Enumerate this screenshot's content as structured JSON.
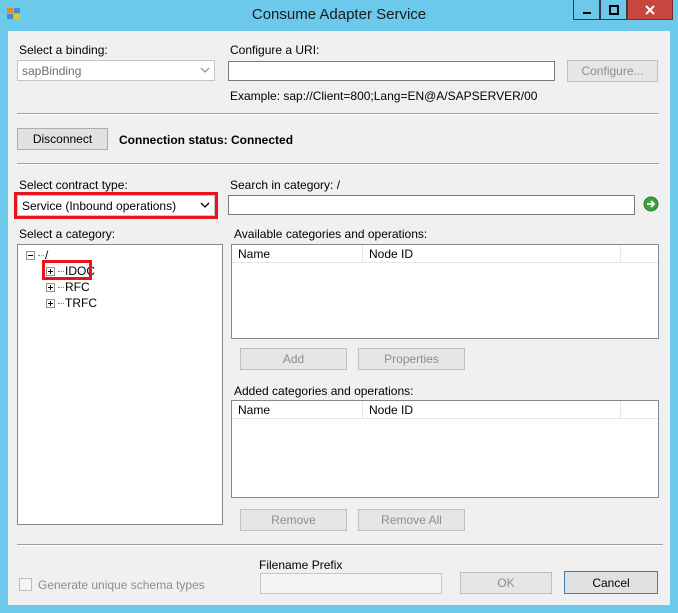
{
  "window": {
    "title": "Consume Adapter Service"
  },
  "binding": {
    "label": "Select a binding:",
    "value": "sapBinding"
  },
  "uri": {
    "label": "Configure a URI:",
    "value": "",
    "configure_label": "Configure...",
    "example": "Example: sap://Client=800;Lang=EN@A/SAPSERVER/00"
  },
  "connection": {
    "disconnect_label": "Disconnect",
    "status_label": "Connection status:",
    "status_value": "Connected"
  },
  "contract": {
    "label": "Select contract type:",
    "value": "Service (Inbound operations)"
  },
  "search": {
    "label": "Search in category: /",
    "value": ""
  },
  "category": {
    "label": "Select a category:",
    "tree": {
      "root": "/",
      "children": [
        "IDOC",
        "RFC",
        "TRFC"
      ]
    }
  },
  "available": {
    "label": "Available categories and operations:",
    "columns": [
      "Name",
      "Node ID"
    ],
    "add_label": "Add",
    "properties_label": "Properties"
  },
  "added": {
    "label": "Added categories and operations:",
    "columns": [
      "Name",
      "Node ID"
    ],
    "remove_label": "Remove",
    "remove_all_label": "Remove All"
  },
  "footer": {
    "generate_label": "Generate unique schema types",
    "filename_prefix_label": "Filename Prefix",
    "filename_prefix_value": "",
    "ok_label": "OK",
    "cancel_label": "Cancel"
  },
  "colors": {
    "titlebar": "#6cc9ec",
    "close_button": "#c7463d",
    "highlight": "#e8141c",
    "go_arrow": "#3aa23a"
  }
}
